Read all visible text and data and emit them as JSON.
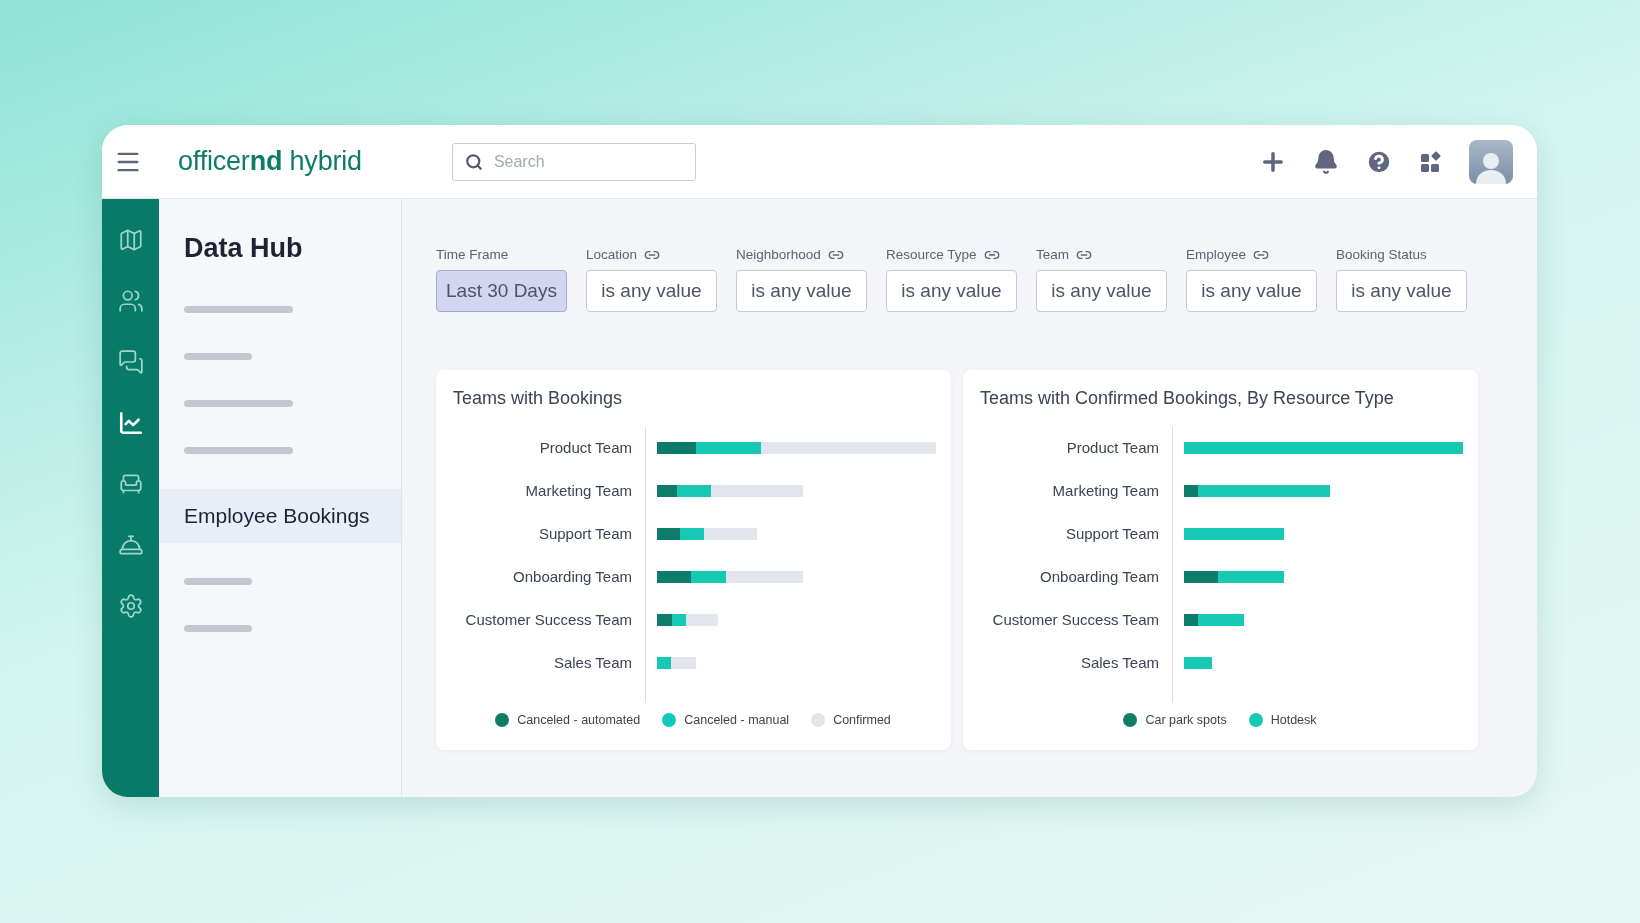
{
  "header": {
    "logo_light": "officer",
    "logo_bold": "nd",
    "logo_rest": " hybrid",
    "search": {
      "placeholder": "Search"
    }
  },
  "rail": [
    {
      "kind": "map",
      "selected": false
    },
    {
      "kind": "people",
      "selected": false
    },
    {
      "kind": "chat",
      "selected": false
    },
    {
      "kind": "analytics",
      "selected": true
    },
    {
      "kind": "desk",
      "selected": false
    },
    {
      "kind": "bell",
      "selected": false
    },
    {
      "kind": "settings",
      "selected": false
    }
  ],
  "sidebar": {
    "title": "Data Hub",
    "items": [
      {
        "kind": "skeleton_long",
        "selected": false
      },
      {
        "kind": "skeleton_short",
        "selected": false
      },
      {
        "kind": "skeleton_long",
        "selected": false
      },
      {
        "kind": "skeleton_long",
        "selected": false
      },
      {
        "kind": "link",
        "label": "Employee Bookings",
        "selected": true
      },
      {
        "kind": "skeleton_short",
        "selected": false
      },
      {
        "kind": "skeleton_short",
        "selected": false
      }
    ]
  },
  "filters": [
    {
      "label": "Time Frame",
      "value": "Last 30 Days",
      "linked": false,
      "active": true
    },
    {
      "label": "Location",
      "value": "is any value",
      "linked": true,
      "active": false
    },
    {
      "label": "Neighborhood",
      "value": "is any value",
      "linked": true,
      "active": false
    },
    {
      "label": "Resource Type",
      "value": "is any value",
      "linked": true,
      "active": false
    },
    {
      "label": "Team",
      "value": "is any value",
      "linked": true,
      "active": false
    },
    {
      "label": "Employee",
      "value": "is any value",
      "linked": true,
      "active": false
    },
    {
      "label": "Booking Status",
      "value": "is any value",
      "linked": false,
      "active": false
    }
  ],
  "charts": [
    {
      "title": "Teams with Bookings",
      "categories": [
        "Product Team",
        "Marketing Team",
        "Support Team",
        "Onboarding Team",
        "Customer Success Team",
        "Sales Team"
      ],
      "legend": [
        {
          "label": "Canceled - automated",
          "color": "#0e7c6b"
        },
        {
          "label": "Canceled - manual",
          "color": "#17c9b5"
        },
        {
          "label": "Confirmed",
          "color": "#e3e5ee"
        }
      ]
    },
    {
      "title": "Teams with Confirmed Bookings, By Resource Type",
      "categories": [
        "Product Team",
        "Marketing Team",
        "Support Team",
        "Onboarding Team",
        "Customer Success Team",
        "Sales Team"
      ],
      "legend": [
        {
          "label": "Car park spots",
          "color": "#0e7c6b"
        },
        {
          "label": "Hotdesk",
          "color": "#17c9b5"
        }
      ]
    }
  ]
}
